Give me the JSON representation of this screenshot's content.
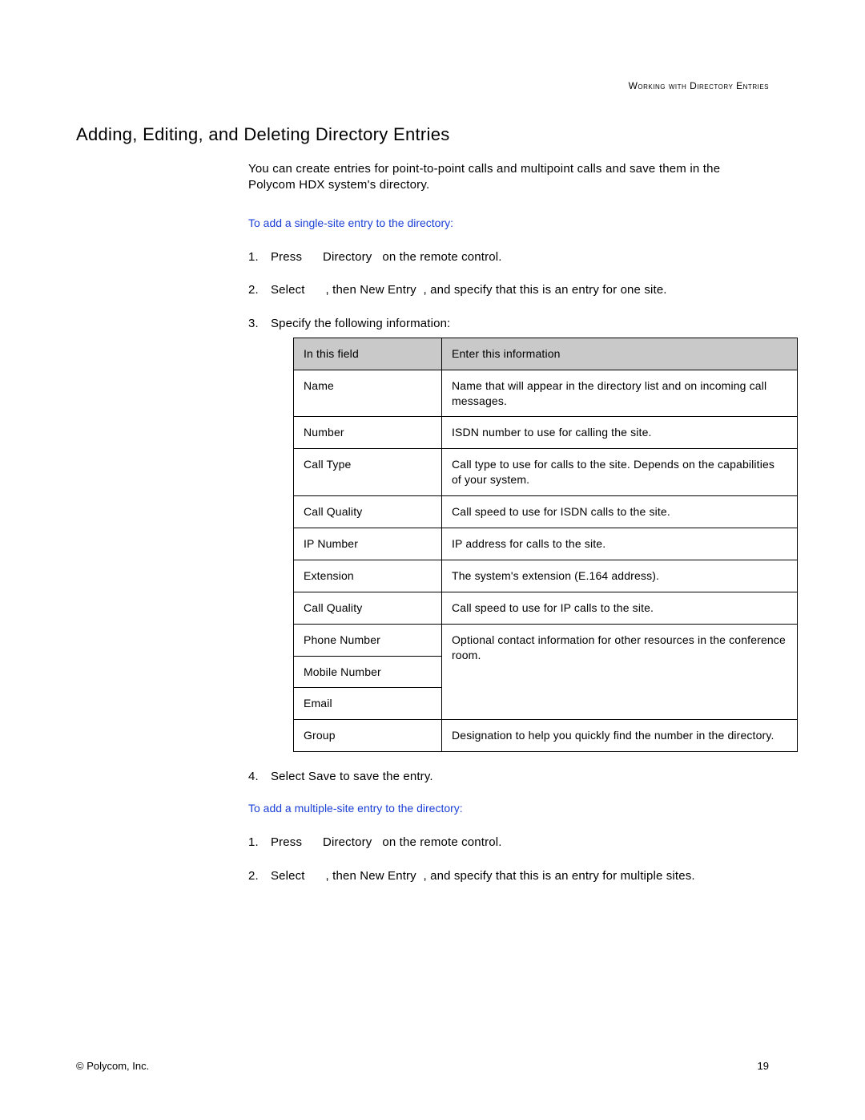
{
  "running_head": "Working with Directory Entries",
  "section_title": "Adding, Editing, and Deleting Directory Entries",
  "intro": "You can create entries for point-to-point calls and multipoint calls and save them in the Polycom HDX system's directory.",
  "task_single": "To add a single-site entry to the directory:",
  "steps_single": {
    "s1_a": "Press ",
    "s1_b": "Directory",
    "s1_c": " on the remote control.",
    "s2_a": "Select ",
    "s2_b": ", then ",
    "s2_c": "New Entry",
    "s2_d": ", and specify that this is an entry for one site.",
    "s3": "Specify the following information:",
    "s4_a": "Select ",
    "s4_b": "Save",
    "s4_c": " to save the entry."
  },
  "table": {
    "head_field": "In this field",
    "head_info": "Enter this information",
    "rows": [
      {
        "field": "Name",
        "info": "Name that will appear in the directory list and on incoming call messages."
      },
      {
        "field": "Number",
        "info": "ISDN number to use for calling the site."
      },
      {
        "field": "Call Type",
        "info": "Call type to use for calls to the site. Depends on the capabilities of your system."
      },
      {
        "field": "Call Quality",
        "info": "Call speed to use for ISDN calls to the site."
      },
      {
        "field": "IP Number",
        "info": "IP address for calls to the site."
      },
      {
        "field": "Extension",
        "info": "The system's extension (E.164 address)."
      },
      {
        "field": "Call Quality",
        "info": "Call speed to use for IP calls to the site."
      },
      {
        "field": "Phone Number",
        "info": "Optional contact information for other resources in the conference room."
      },
      {
        "field": "Mobile Number",
        "info": ""
      },
      {
        "field": "Email",
        "info": ""
      },
      {
        "field": "Group",
        "info": "Designation to help you quickly find the number in the directory."
      }
    ]
  },
  "task_multi": "To add a multiple-site entry to the directory:",
  "steps_multi": {
    "s1_a": "Press ",
    "s1_b": "Directory",
    "s1_c": " on the remote control.",
    "s2_a": "Select ",
    "s2_b": ", then ",
    "s2_c": "New Entry",
    "s2_d": ", and specify that this is an entry for multiple sites."
  },
  "footer_left": "© Polycom, Inc.",
  "footer_right": "19"
}
